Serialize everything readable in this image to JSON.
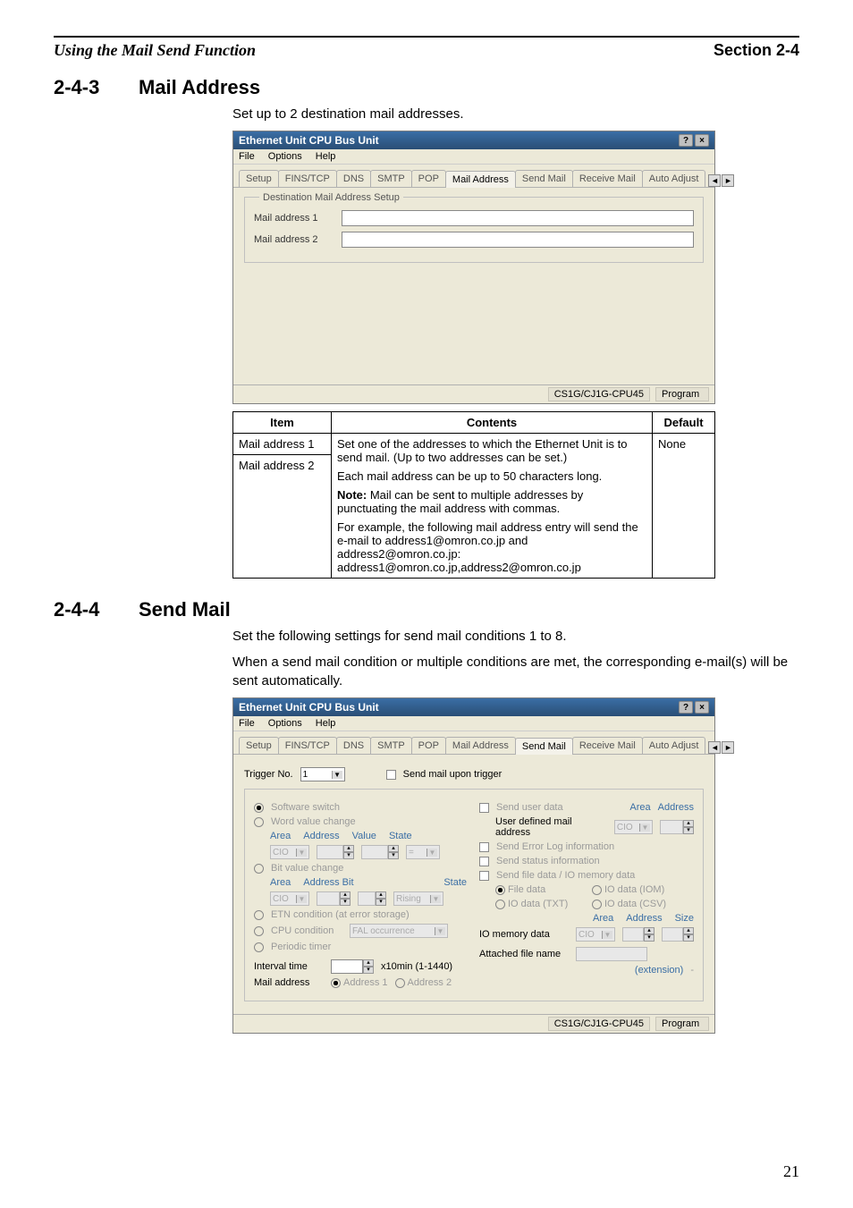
{
  "header": {
    "left": "Using the Mail Send Function",
    "right": "Section 2-4"
  },
  "sec1": {
    "num": "2-4-3",
    "title": "Mail Address",
    "intro": "Set up to 2 destination mail addresses."
  },
  "win1": {
    "title": "Ethernet Unit CPU Bus Unit",
    "menu": {
      "file": "File",
      "options": "Options",
      "help": "Help"
    },
    "tabs": {
      "t0": "Setup",
      "t1": "FINS/TCP",
      "t2": "DNS",
      "t3": "SMTP",
      "t4": "POP",
      "t5": "Mail Address",
      "t6": "Send Mail",
      "t7": "Receive Mail",
      "t8": "Auto Adjust"
    },
    "legend": "Destination Mail Address Setup",
    "label1": "Mail address 1",
    "label2": "Mail address 2",
    "status1": "CS1G/CJ1G-CPU45",
    "status2": "Program"
  },
  "table1": {
    "h_item": "Item",
    "h_contents": "Contents",
    "h_default": "Default",
    "r1_item": "Mail address 1",
    "r2_item": "Mail address 2",
    "contents_p1": "Set one of the addresses to which the Ethernet Unit is to send mail. (Up to two addresses can be set.)",
    "contents_p2": "Each mail address can be up to 50 characters long.",
    "contents_p3a": "Note:",
    "contents_p3b": " Mail can be sent to multiple addresses by punctuating the mail address with commas.",
    "contents_p4": "For example, the following mail address entry will send the e-mail to address1@omron.co.jp and address2@omron.co.jp:",
    "contents_p5": "address1@omron.co.jp,address2@omron.co.jp",
    "default": "None"
  },
  "sec2": {
    "num": "2-4-4",
    "title": "Send Mail",
    "p1": "Set the following settings for send mail conditions 1 to 8.",
    "p2": "When a send mail condition or multiple conditions are met, the corresponding e-mail(s) will be sent automatically."
  },
  "win2": {
    "title": "Ethernet Unit CPU Bus Unit",
    "menu": {
      "file": "File",
      "options": "Options",
      "help": "Help"
    },
    "tabs": {
      "t0": "Setup",
      "t1": "FINS/TCP",
      "t2": "DNS",
      "t3": "SMTP",
      "t4": "POP",
      "t5": "Mail Address",
      "t6": "Send Mail",
      "t7": "Receive Mail",
      "t8": "Auto Adjust"
    },
    "trigger_label": "Trigger No.",
    "trigger_sel": "1",
    "chk_send": "Send mail upon trigger",
    "left": {
      "r_soft": "Software switch",
      "r_word": "Word value change",
      "hdr_area": "Area",
      "hdr_addr": "Address",
      "hdr_val": "Value",
      "hdr_state": "State",
      "sel_area": "CIO",
      "r_bit": "Bit value change",
      "hdr_bit": "Address  Bit",
      "sel_rising": "Rising",
      "r_etn": "ETN condition (at error storage)",
      "r_cpu": "CPU condition",
      "sel_fal": "FAL occurrence",
      "r_periodic": "Periodic timer",
      "interval_label": "Interval time",
      "interval_suffix": "x10min (1-1440)",
      "mail_addr_label": "Mail address",
      "mail_r1": "Address 1",
      "mail_r2": "Address 2"
    },
    "right": {
      "chk_userdata": "Send user data",
      "hdr_area": "Area",
      "hdr_addr": "Address",
      "udma": "User defined mail address",
      "sel_area": "CIO",
      "chk_errlog": "Send Error Log information",
      "chk_status": "Send status information",
      "chk_filedata": "Send file data / IO memory data",
      "r_filedata": "File data",
      "r_iodata_iom": "IO data (IOM)",
      "r_iodata_txt": "IO data (TXT)",
      "r_iodata_csv": "IO data (CSV)",
      "hdr_size": "Size",
      "iomem_label": "IO memory data",
      "attached_label": "Attached file name",
      "ext_label": "(extension)"
    },
    "status1": "CS1G/CJ1G-CPU45",
    "status2": "Program"
  },
  "page_number": "21"
}
